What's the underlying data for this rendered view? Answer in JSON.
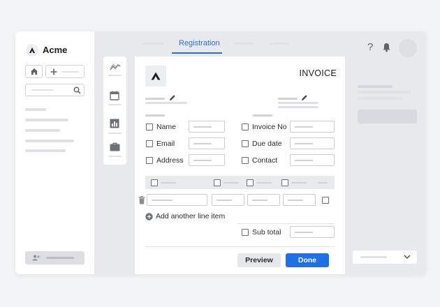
{
  "sidebar": {
    "brand": "Acme",
    "icons": {
      "logo": "acme-logo",
      "home": "home-icon",
      "add": "plus-icon",
      "search": "search-icon",
      "user": "user-icon"
    }
  },
  "toolbar": {
    "active_tab": "Registration",
    "icons": {
      "help": "question-icon",
      "notifications": "bell-icon",
      "avatar": "avatar"
    }
  },
  "tools": [
    "chart-line-icon",
    "calendar-icon",
    "bar-chart-icon",
    "briefcase-icon"
  ],
  "invoice": {
    "title": "INVOICE",
    "left_fields": [
      {
        "label": "Name"
      },
      {
        "label": "Email"
      },
      {
        "label": "Address"
      }
    ],
    "right_fields": [
      {
        "label": "Invoice No"
      },
      {
        "label": "Due date"
      },
      {
        "label": "Contact"
      }
    ],
    "add_line_item": "Add another line item",
    "subtotal_label": "Sub total",
    "buttons": {
      "preview": "Preview",
      "done": "Done"
    },
    "colors": {
      "primary": "#1f6fe5",
      "tab_active": "#2d6fc7"
    }
  }
}
